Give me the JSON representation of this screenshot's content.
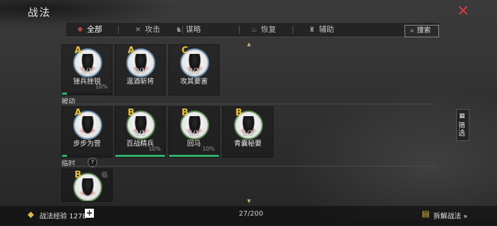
{
  "header": {
    "title": "战法",
    "close_icon": "close-icon"
  },
  "tabs": [
    {
      "label": "全部",
      "icon": "all-icon",
      "active": true
    },
    {
      "label": "攻击",
      "icon": "swords-icon",
      "active": false
    },
    {
      "label": "谋略",
      "icon": "scheme-icon",
      "active": false
    },
    {
      "label": "恢复",
      "icon": "heal-icon",
      "active": false
    },
    {
      "label": "辅助",
      "icon": "support-icon",
      "active": false
    }
  ],
  "search": {
    "label": "搜索",
    "icon": "search-icon"
  },
  "sections": {
    "passive_label": "被动",
    "temporary_label": "临时",
    "temporary_help": "?"
  },
  "cards_top": [
    {
      "grade": "A",
      "level": "1/1",
      "name": "锉兵挫锐",
      "pct": "10%",
      "progress": 0.1,
      "ring": "blue"
    },
    {
      "grade": "A",
      "level": "0/1",
      "name": "温酒斩将",
      "pct": "",
      "progress": 0,
      "ring": "blue"
    },
    {
      "grade": "C",
      "level": "2/2",
      "name": "攻其要害",
      "pct": "",
      "progress": 0,
      "ring": "blue"
    }
  ],
  "cards_passive": [
    {
      "grade": "A",
      "level": "",
      "name": "步步为营",
      "pct": "",
      "progress": 0.1,
      "ring": "blue"
    },
    {
      "grade": "B",
      "level": "1/1",
      "name": "百战精兵",
      "pct": "10%",
      "progress": 1.0,
      "ring": "green"
    },
    {
      "grade": "B",
      "level": "1/1",
      "name": "回马",
      "pct": "10%",
      "progress": 1.0,
      "ring": "green"
    },
    {
      "grade": "B",
      "level": "1/2",
      "name": "青囊秘要",
      "pct": "",
      "progress": 0,
      "ring": "green"
    }
  ],
  "cards_temporary": [
    {
      "grade": "B",
      "level": "",
      "name": "",
      "pct": "",
      "progress": 0,
      "ring": "green",
      "tag": "临"
    }
  ],
  "filter": {
    "label": "筛选",
    "icon": "grid-icon"
  },
  "footer": {
    "exp_label": "战法经验 1278",
    "exp_icon": "book-icon",
    "add_label": "+",
    "count": "27/200",
    "decompose_label": "拆解战法 »",
    "decompose_icon": "scroll-icon"
  },
  "colors": {
    "accent": "#d23a3a",
    "grade": "#e8c040",
    "progress": "#2fb06a"
  }
}
